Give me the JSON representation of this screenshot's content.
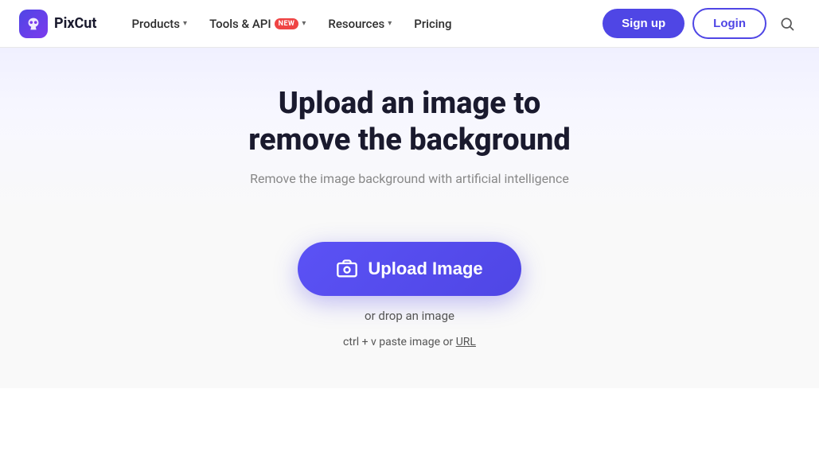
{
  "brand": {
    "name": "PixCut",
    "logo_alt": "PixCut logo"
  },
  "navbar": {
    "products_label": "Products",
    "tools_api_label": "Tools & API",
    "tools_badge": "NEW",
    "resources_label": "Resources",
    "pricing_label": "Pricing",
    "signup_label": "Sign up",
    "login_label": "Login"
  },
  "hero": {
    "title_line1": "Upload an image to",
    "title_line2": "remove the background",
    "subtitle": "Remove the image background with artificial intelligence"
  },
  "upload": {
    "button_label": "Upload Image",
    "drop_text": "or drop an image",
    "paste_text": "ctrl + v paste image or ",
    "paste_link": "URL"
  },
  "colors": {
    "primary": "#4f46e5",
    "primary_hover": "#4338ca"
  }
}
